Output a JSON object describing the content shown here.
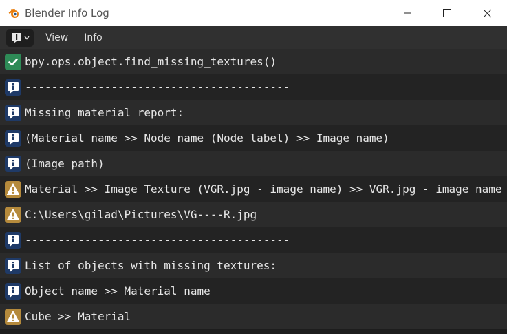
{
  "window": {
    "title": "Blender Info Log"
  },
  "header": {
    "menus": [
      "View",
      "Info"
    ]
  },
  "colors": {
    "operator": "#2e8b57",
    "info": "#1f3a67",
    "warning": "#b58a3c"
  },
  "log": [
    {
      "type": "operator",
      "icon": "checkmark-icon",
      "text": "bpy.ops.object.find_missing_textures()"
    },
    {
      "type": "info",
      "icon": "info-icon",
      "text": "----------------------------------------"
    },
    {
      "type": "info",
      "icon": "info-icon",
      "text": "Missing material report:"
    },
    {
      "type": "info",
      "icon": "info-icon",
      "text": "(Material name >> Node name (Node label) >> Image name)"
    },
    {
      "type": "info",
      "icon": "info-icon",
      "text": "(Image path)"
    },
    {
      "type": "warning",
      "icon": "warning-icon",
      "text": "Material >> Image Texture (VGR.jpg - image name) >> VGR.jpg - image name"
    },
    {
      "type": "warning",
      "icon": "warning-icon",
      "text": "C:\\Users\\gilad\\Pictures\\VG----R.jpg"
    },
    {
      "type": "info",
      "icon": "info-icon",
      "text": "----------------------------------------"
    },
    {
      "type": "info",
      "icon": "info-icon",
      "text": "List of objects with missing textures:"
    },
    {
      "type": "info",
      "icon": "info-icon",
      "text": "Object name >> Material name"
    },
    {
      "type": "warning",
      "icon": "warning-icon",
      "text": "Cube >> Material"
    }
  ]
}
